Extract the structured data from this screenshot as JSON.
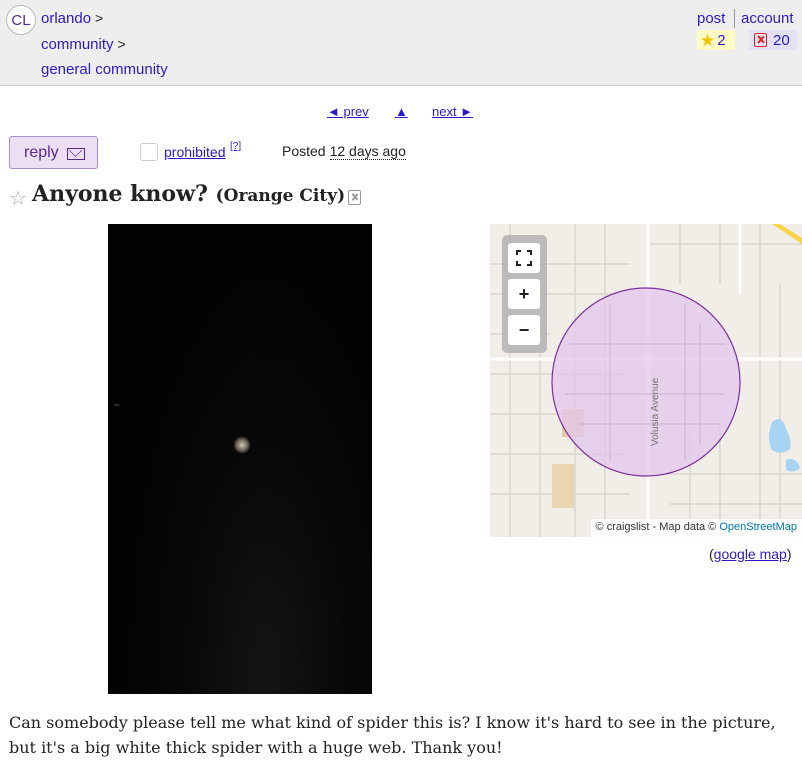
{
  "header": {
    "logo": "CL",
    "breadcrumbs": [
      "orlando",
      "community",
      "general community"
    ],
    "separator": ">",
    "post_label": "post",
    "account_label": "account",
    "favorites_count": "2",
    "hidden_count": "20"
  },
  "nav": {
    "prev_label": "◄ prev",
    "up_label": "▲",
    "next_label": "next ►"
  },
  "actions": {
    "reply_label": "reply",
    "prohibited_label": "prohibited",
    "prohibited_help": "[?]",
    "posted_label": "Posted",
    "posted_ago": "12 days ago"
  },
  "posting": {
    "title": "Anyone know?",
    "location": "(Orange City)",
    "body": "Can somebody please tell me what kind of spider this is? I know it's hard to see in the picture, but it's a big white thick spider with a huge web. Thank you!"
  },
  "map": {
    "street_label": "Volusia Avenue",
    "attribution_prefix": "© craigslist - Map data ©",
    "attribution_link": "OpenStreetMap",
    "google_map_label": "google map",
    "colors": {
      "circle_fill": "#e3c6ec",
      "circle_stroke": "#7d2f9a",
      "water": "#a8d4f4",
      "highway": "#f7d54a"
    }
  },
  "icons": {
    "favorite": "star-icon",
    "hide": "trash-icon",
    "reply": "envelope-icon",
    "fullscreen": "fullscreen-icon",
    "zoom_in": "plus-icon",
    "zoom_out": "minus-icon"
  },
  "colors": {
    "link": "#2b1ac9",
    "visited": "#5a2a8a",
    "reply_bg": "#ecdff4",
    "header_bg": "#eeeeee"
  }
}
